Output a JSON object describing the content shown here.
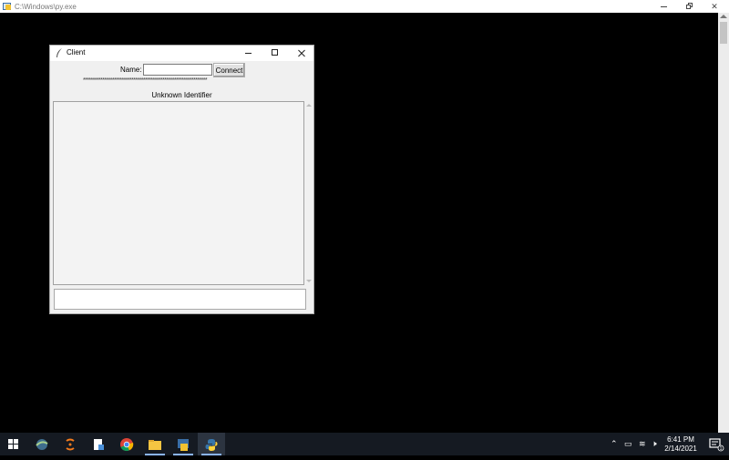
{
  "console": {
    "title": "C:\\Windows\\py.exe"
  },
  "client": {
    "title": "Client",
    "name_label": "Name:",
    "name_value": "",
    "connect_label": "Connect",
    "separator": "****************************************************************",
    "status": "Unknown Identifier",
    "message_value": ""
  },
  "taskbar": {
    "apps": [
      "start",
      "pinned-app-1",
      "pinned-app-2",
      "pinned-app-3",
      "chrome",
      "file-explorer",
      "pinned-app-6",
      "python"
    ],
    "clock_time": "6:41 PM",
    "clock_date": "2/14/2021"
  }
}
